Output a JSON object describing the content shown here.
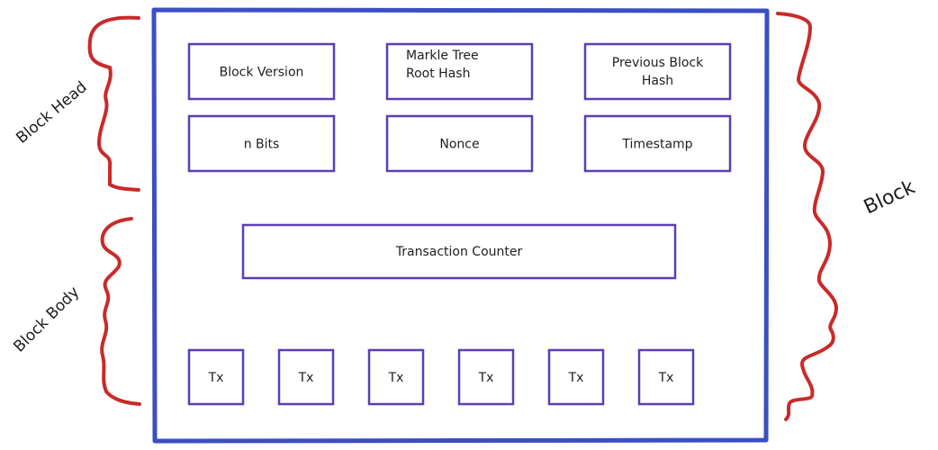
{
  "colors": {
    "outer_block": "#3b4fc4",
    "field_box": "#5b3fb5",
    "brace": "#c92a2a",
    "text": "#1e1e1e"
  },
  "labels": {
    "block": "Block",
    "block_head": "Block Head",
    "block_body": "Block Body"
  },
  "header_fields": [
    {
      "lines": [
        "Block Version"
      ]
    },
    {
      "lines": [
        "Markle Tree",
        "Root Hash"
      ]
    },
    {
      "lines": [
        "Previous Block",
        "Hash"
      ]
    },
    {
      "lines": [
        "n Bits"
      ]
    },
    {
      "lines": [
        "Nonce"
      ]
    },
    {
      "lines": [
        "Timestamp"
      ]
    }
  ],
  "transaction_counter": "Transaction Counter",
  "transactions": [
    "Tx",
    "Tx",
    "Tx",
    "Tx",
    "Tx",
    "Tx"
  ]
}
